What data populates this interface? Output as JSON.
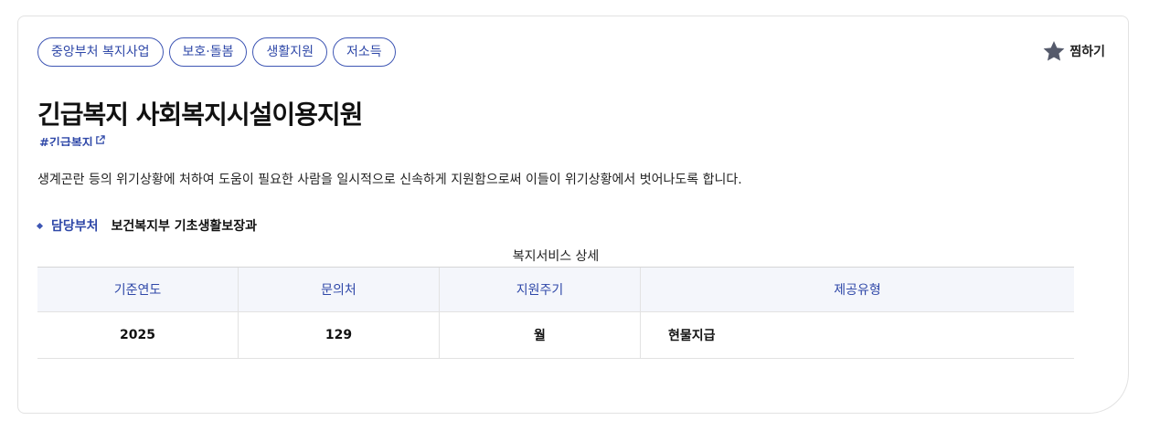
{
  "tags": [
    "중앙부처 복지사업",
    "보호·돌봄",
    "생활지원",
    "저소득"
  ],
  "favorite": {
    "label": "찜하기",
    "icon": "star-icon"
  },
  "title": "긴급복지 사회복지시설이용지원",
  "hashtag": {
    "label": "#긴급복지",
    "icon": "external-link-icon"
  },
  "description": "생계곤란 등의 위기상황에 처하여 도움이 필요한 사람을 일시적으로 신속하게 지원함으로써 이들이 위기상황에서 벗어나도록 합니다.",
  "department": {
    "label": "담당부처",
    "value": "보건복지부 기초생활보장과"
  },
  "table": {
    "caption": "복지서비스 상세",
    "headers": [
      "기준연도",
      "문의처",
      "지원주기",
      "제공유형"
    ],
    "row": [
      "2025",
      "129",
      "월",
      "현물지급"
    ]
  },
  "colors": {
    "accent": "#2f48a8",
    "header_bg": "#f4f6fb",
    "star": "#555a6b"
  }
}
